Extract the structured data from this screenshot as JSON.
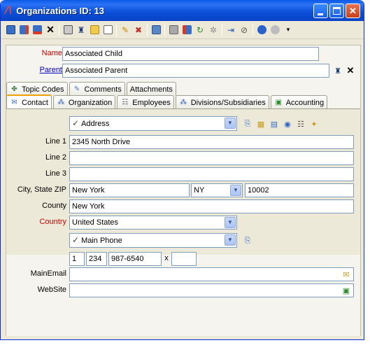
{
  "window": {
    "title": "Organizations ID: 13"
  },
  "toolbar": {
    "icons": [
      "save-icon",
      "save-new-icon",
      "save-close-icon",
      "delete-icon",
      "print-icon",
      "find-icon",
      "open-folder-icon",
      "list-icon",
      "edit-icon",
      "remove-icon",
      "copy-record-icon",
      "attach-icon",
      "merge-icon",
      "refresh-icon",
      "settings-icon",
      "goto-icon",
      "clear-icon",
      "help-icon",
      "info-icon",
      "more-icon"
    ]
  },
  "form": {
    "name_label": "Name",
    "name_value": "Associated Child",
    "parent_label": "Parent",
    "parent_value": "Associated Parent"
  },
  "tabs_row1": [
    {
      "label": "Topic Codes"
    },
    {
      "label": "Comments"
    },
    {
      "label": "Attachments"
    }
  ],
  "tabs_row2": [
    {
      "label": "Contact"
    },
    {
      "label": "Organization"
    },
    {
      "label": "Employees"
    },
    {
      "label": "Divisions/Subsidiaries"
    },
    {
      "label": "Accounting"
    }
  ],
  "contact": {
    "address_type": "Address",
    "line1_label": "Line 1",
    "line1_value": "2345 North Drive",
    "line2_label": "Line 2",
    "line2_value": "",
    "line3_label": "Line 3",
    "line3_value": "",
    "csz_label": "City, State ZIP",
    "city_value": "New York",
    "state_value": "NY",
    "zip_value": "10002",
    "county_label": "County",
    "county_value": "New York",
    "country_label": "Country",
    "country_value": "United States",
    "phone_type": "Main Phone",
    "phone_country": "1",
    "phone_area": "234",
    "phone_number": "987-6540",
    "ext_label": "x",
    "phone_ext": "",
    "email_label": "MainEmail",
    "email_value": "",
    "website_label": "WebSite",
    "website_value": ""
  }
}
